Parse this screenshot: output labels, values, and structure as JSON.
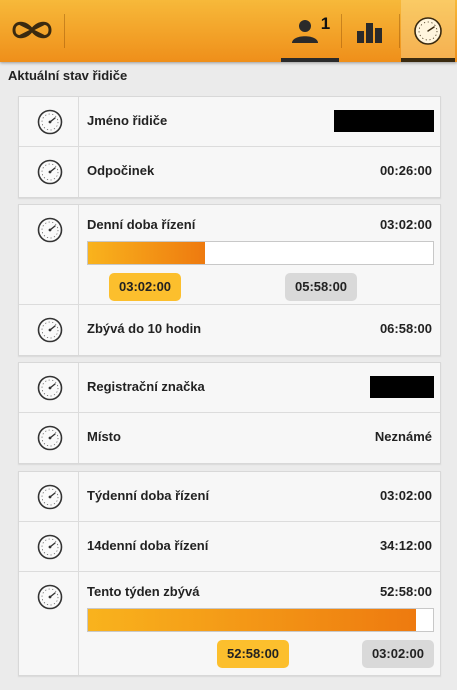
{
  "header": {
    "tabs": [
      {
        "id": "driver",
        "icon": "driver-icon",
        "badge": "1"
      },
      {
        "id": "stats",
        "icon": "bar-chart-icon"
      },
      {
        "id": "gauge",
        "icon": "gauge-icon",
        "active": true
      }
    ]
  },
  "section_title": "Aktuální stav řidiče",
  "rows": {
    "driver_name": {
      "label": "Jméno řidiče",
      "value_redacted": true
    },
    "rest": {
      "label": "Odpočinek",
      "value": "00:26:00"
    },
    "daily": {
      "label": "Denní doba řízení",
      "value": "03:02:00",
      "progress": 0.34,
      "pill_used": "03:02:00",
      "pill_remaining": "05:58:00"
    },
    "remaining10": {
      "label": "Zbývá do 10 hodin",
      "value": "06:58:00"
    },
    "plate": {
      "label": "Registrační značka",
      "value_redacted": true
    },
    "place": {
      "label": "Místo",
      "value": "Neznámé"
    },
    "weekly": {
      "label": "Týdenní doba řízení",
      "value": "03:02:00"
    },
    "biweekly": {
      "label": "14denní doba řízení",
      "value": "34:12:00"
    },
    "week_left": {
      "label": "Tento týden zbývá",
      "value": "52:58:00",
      "progress": 0.95,
      "pill_used": "52:58:00",
      "pill_remaining": "03:02:00"
    }
  },
  "colors": {
    "accent": "#f39c1f",
    "pill_orange": "#fcbf2d",
    "pill_grey": "#d9d9d9"
  }
}
